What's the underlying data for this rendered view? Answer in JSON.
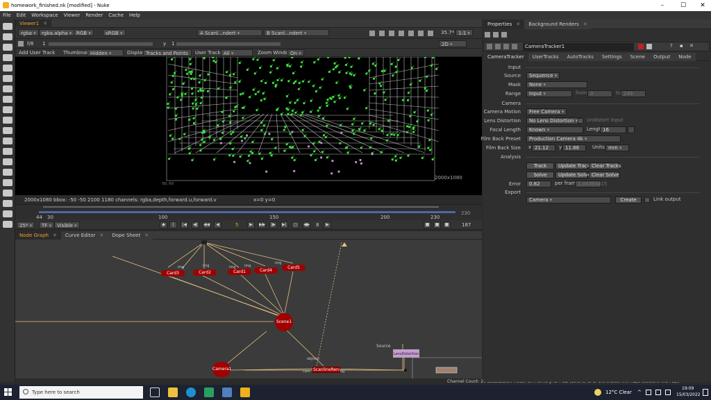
{
  "window": {
    "title": "homework_finished.nk [modified] - Nuke",
    "controls": [
      "–",
      "☐",
      "✕"
    ]
  },
  "menu": [
    "File",
    "Edit",
    "Workspace",
    "Viewer",
    "Render",
    "Cache",
    "Help"
  ],
  "viewer": {
    "tab": "Viewer1",
    "channels": "rgba",
    "alpha": "rgba.alpha",
    "display": "RGB",
    "colorspace": "sRGB",
    "input_a": "A  Scanl...ndert",
    "input_b": "B  Scanl...ndert",
    "zoom": "35.7*",
    "ratio": "1:1",
    "view_mode": "2D",
    "fstop": "f/8",
    "gain_val": "1",
    "y_label": "y",
    "y_val": "1",
    "add_user_track": "Add User Track",
    "thumbnails_label": "Thumbnails",
    "thumbnails_val": "Hidden",
    "display_label": "Display",
    "display_val": "Tracks and Points",
    "user_tracks_label": "User Tracks",
    "user_tracks_val": "All",
    "zoom_window_label": "Zoom Window",
    "zoom_window_val": "On",
    "format_label": "2000x1080",
    "corner_label": "-50,-50",
    "info_line": "2000x1080  bbox: -50 -50 2100 1180 channels: rgba,depth,forward.u,forward.v",
    "coords": "x=0 y=0"
  },
  "timeline": {
    "start": "44",
    "start2": "30",
    "ticks": [
      "100",
      "150",
      "200"
    ],
    "end": "230",
    "end_top": "230",
    "fps": "25*",
    "tf": "TF",
    "visible": "Visible",
    "current_frame": "5",
    "increment": "8",
    "last_frame": "187"
  },
  "nodegraph": {
    "tabs": [
      "Node Graph",
      "Curve Editor",
      "Dope Sheet"
    ],
    "nodes": {
      "card3": "Card3",
      "card2": "Card2",
      "card1": "Card1",
      "card4": "Card4",
      "card5": "Card5",
      "scene": "Scene1",
      "camera": "Camera1",
      "scanline": "ScanlineRender",
      "lens": "LensDistortion"
    },
    "input_labels": {
      "img": "img",
      "obj": "obj/scn",
      "cam": "cam",
      "bg": "bg",
      "source": "Source"
    }
  },
  "properties": {
    "tabs": [
      "Properties",
      "Background Renders"
    ],
    "node_name": "CameraTracker1",
    "subtabs": [
      "CameraTracker",
      "UserTracks",
      "AutoTracks",
      "Settings",
      "Scene",
      "Output",
      "Node"
    ],
    "sections": {
      "input": "Input",
      "camera": "Camera",
      "analysis": "Analysis",
      "export": "Export"
    },
    "source_label": "Source",
    "source_val": "Sequence",
    "mask_label": "Mask",
    "mask_val": "None",
    "range_label": "Range",
    "range_val": "Input",
    "from_label": "from",
    "from_val": "0",
    "to_label": "to",
    "to_val": "249",
    "motion_label": "Camera Motion",
    "motion_val": "Free Camera",
    "lens_label": "Lens Distortion",
    "lens_val": "No Lens Distortion",
    "undistort_label": "Undistort Input",
    "focal_label": "Focal Length",
    "focal_val": "Known",
    "length_label": "Length",
    "length_val": "16",
    "filmback_label": "Film Back Preset",
    "filmback_val": "Production Camera 4k",
    "filmsize_label": "Film Back Size",
    "fx_label": "x",
    "fx_val": "21.12",
    "fy_label": "y",
    "fy_val": "11.88",
    "units_label": "Units",
    "units_val": "mm",
    "btn_track": "Track",
    "btn_update_track": "Update Track",
    "btn_clear_tracks": "Clear Tracks",
    "btn_solve": "Solve",
    "btn_update_solve": "Update Solve",
    "btn_clear_solve": "Clear Solve",
    "error_label": "Error",
    "error_val": "0.82",
    "perframe_label": "per frame",
    "perframe_val": "1.04393415",
    "export_val": "Camera",
    "btn_create": "Create",
    "link_output_label": "Link output"
  },
  "status": "Channel Count: 20  Localization Mode: On  Memory: 2.4 GB (15.3%)  CPU: 1.5%  Disk: 0.0 MB/s  Network: 0.1 MB/s",
  "taskbar": {
    "search_placeholder": "Type here to search",
    "weather": "12°C  Clear",
    "time": "19:09",
    "date": "15/03/2022"
  },
  "colors": {
    "accent": "#f0a030",
    "node": "#a00000",
    "track_point": "#3cdc3c",
    "edge": "#e8c080"
  }
}
